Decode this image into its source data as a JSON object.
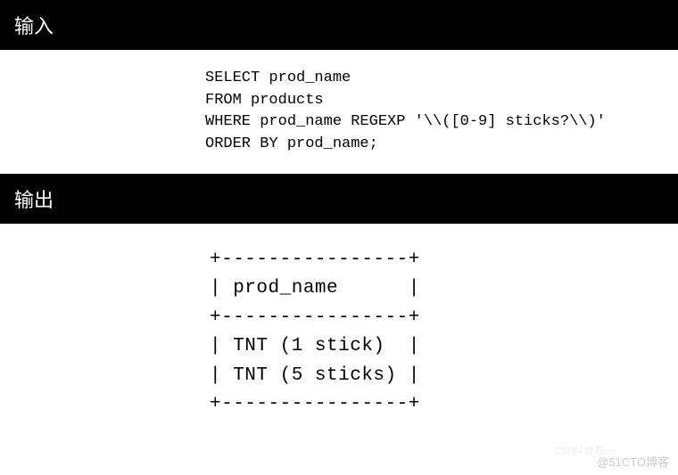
{
  "sections": {
    "input_header": "输入",
    "output_header": "输出"
  },
  "sql": {
    "line1": "SELECT prod_name",
    "line2": "FROM products",
    "line3": "WHERE prod_name REGEXP '\\\\([0-9] sticks?\\\\)'",
    "line4": "ORDER BY prod_name;"
  },
  "output": {
    "border_top": "+----------------+",
    "header_row": "| prod_name      |",
    "border_mid": "+----------------+",
    "row1": "| TNT (1 stick)  |",
    "row2": "| TNT (5 sticks) |",
    "border_bottom": "+----------------+"
  },
  "watermark": {
    "main": "@51CTO博客",
    "faint": "CSDN @若~~"
  }
}
